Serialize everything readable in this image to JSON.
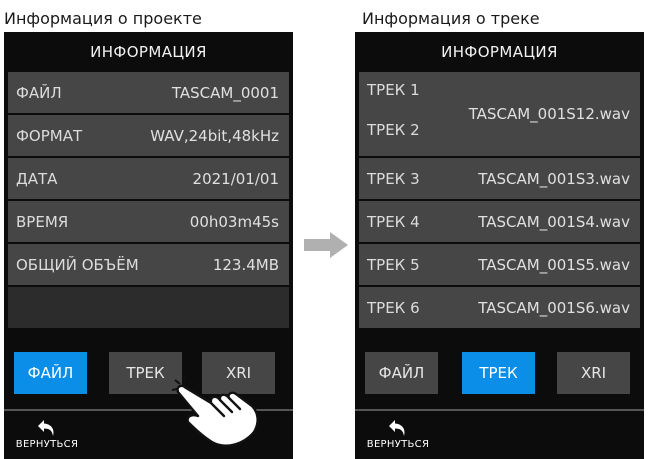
{
  "left": {
    "caption": "Информация о проекте",
    "header": "ИНФОРМАЦИЯ",
    "rows": [
      {
        "label": "ФАЙЛ",
        "value": "TASCAM_0001"
      },
      {
        "label": "ФОРМАТ",
        "value": "WAV,24bit,48kHz"
      },
      {
        "label": "ДАТА",
        "value": "2021/01/01"
      },
      {
        "label": "ВРЕМЯ",
        "value": "00h03m45s"
      },
      {
        "label": "ОБЩИЙ ОБЪЁМ",
        "value": "123.4MB"
      }
    ],
    "tabs": [
      "ФАЙЛ",
      "ТРЕК",
      "XRI"
    ],
    "active_tab": "ФАЙЛ",
    "back_label": "ВЕРНУТЬСЯ"
  },
  "right": {
    "caption": "Информация о треке",
    "header": "ИНФОРМАЦИЯ",
    "stereo_row": {
      "label1": "ТРЕК 1",
      "label2": "ТРЕК 2",
      "value": "TASCAM_001S12.wav"
    },
    "rows": [
      {
        "label": "ТРЕК 3",
        "value": "TASCAM_001S3.wav"
      },
      {
        "label": "ТРЕК 4",
        "value": "TASCAM_001S4.wav"
      },
      {
        "label": "ТРЕК 5",
        "value": "TASCAM_001S5.wav"
      },
      {
        "label": "ТРЕК 6",
        "value": "TASCAM_001S6.wav"
      }
    ],
    "tabs": [
      "ФАЙЛ",
      "ТРЕК",
      "XRI"
    ],
    "active_tab": "ТРЕК",
    "back_label": "ВЕРНУТЬСЯ"
  },
  "icons": {
    "transition_arrow": "arrow-right-icon",
    "tap_hand": "hand-pointer-icon",
    "back": "undo-arrow-icon"
  },
  "colors": {
    "active_tab": "#0a8ee8",
    "row_bg": "#464646",
    "screen_bg": "#0c0c0c",
    "arrow": "#b0b0b0"
  }
}
